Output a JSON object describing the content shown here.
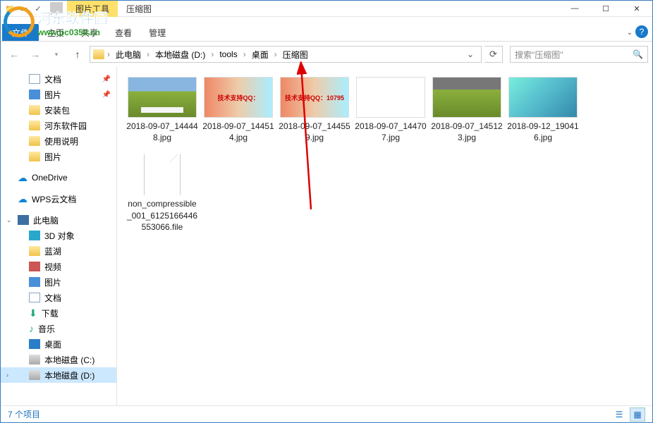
{
  "context_tab": "图片工具",
  "extra_tab": "压缩图",
  "ribbon": {
    "file": "文件",
    "home": "主页",
    "share": "共享",
    "view": "查看",
    "manage": "管理"
  },
  "breadcrumb": [
    "此电脑",
    "本地磁盘 (D:)",
    "tools",
    "桌面",
    "压缩图"
  ],
  "search_placeholder": "搜索\"压缩图\"",
  "sidebar": {
    "quick": [
      {
        "label": "文档",
        "icon": "doc",
        "pinned": true
      },
      {
        "label": "图片",
        "icon": "pic",
        "pinned": true
      },
      {
        "label": "安装包",
        "icon": "folder"
      },
      {
        "label": "河东软件园",
        "icon": "folder"
      },
      {
        "label": "使用说明",
        "icon": "folder"
      },
      {
        "label": "图片",
        "icon": "folder"
      }
    ],
    "onedrive": "OneDrive",
    "wps": "WPS云文档",
    "thispc": "此电脑",
    "pcitems": [
      {
        "label": "3D 对象",
        "icon": "3d"
      },
      {
        "label": "蓝湖",
        "icon": "folder"
      },
      {
        "label": "视频",
        "icon": "video"
      },
      {
        "label": "图片",
        "icon": "pic"
      },
      {
        "label": "文档",
        "icon": "doc"
      },
      {
        "label": "下载",
        "icon": "dl"
      },
      {
        "label": "音乐",
        "icon": "music"
      },
      {
        "label": "桌面",
        "icon": "desktop"
      },
      {
        "label": "本地磁盘 (C:)",
        "icon": "disk"
      },
      {
        "label": "本地磁盘 (D:)",
        "icon": "disk",
        "selected": true
      }
    ]
  },
  "files": [
    {
      "name": "2018-09-07_144448.jpg",
      "thumb": "grass"
    },
    {
      "name": "2018-09-07_144514.jpg",
      "thumb": "banner",
      "overlay": "技术支持QQ："
    },
    {
      "name": "2018-09-07_144559.jpg",
      "thumb": "banner",
      "overlay": "技术支持QQ：10795"
    },
    {
      "name": "2018-09-07_144707.jpg",
      "thumb": "white"
    },
    {
      "name": "2018-09-07_145123.jpg",
      "thumb": "grass2"
    },
    {
      "name": "2018-09-12_190416.jpg",
      "thumb": "jelly"
    },
    {
      "name": "non_compressible_001_6125166446553066.file",
      "thumb": "none"
    }
  ],
  "status": {
    "count": "7 个项目"
  },
  "watermark": {
    "title": "河东软件园",
    "url": "www.pc0359.cn"
  }
}
